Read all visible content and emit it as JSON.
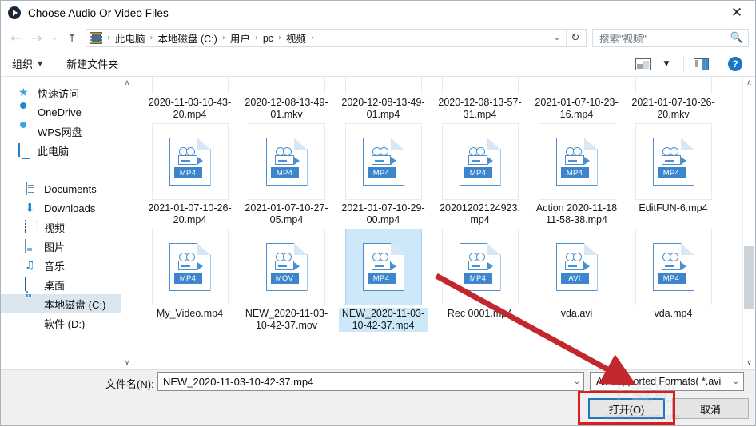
{
  "window": {
    "title": "Choose Audio Or Video Files",
    "app_icon": "play-circle-icon",
    "close_label": "✕"
  },
  "nav": {
    "back": "←",
    "forward": "→",
    "history": "⌄",
    "up": "↑",
    "breadcrumb": [
      "此电脑",
      "本地磁盘 (C:)",
      "用户",
      "pc",
      "视频"
    ],
    "separator": "›",
    "dropdown": "⌄",
    "refresh": "↻"
  },
  "search": {
    "placeholder": "搜索\"视频\"",
    "icon": "search-icon"
  },
  "toolbar": {
    "organize": "组织",
    "organize_caret": "▼",
    "new_folder": "新建文件夹",
    "view_caret": "▼",
    "help": "?"
  },
  "sidebar": {
    "items": [
      {
        "label": "快速访问",
        "icon": "star-icon",
        "indent": false,
        "selected": false
      },
      {
        "label": "OneDrive",
        "icon": "cloud-icon",
        "indent": false,
        "selected": false
      },
      {
        "label": "WPS网盘",
        "icon": "wps-cloud-icon",
        "indent": false,
        "selected": false
      },
      {
        "label": "此电脑",
        "icon": "this-pc-icon",
        "indent": false,
        "selected": false
      },
      {
        "label": "",
        "icon": "green-app-icon",
        "indent": true,
        "selected": false
      },
      {
        "label": "Documents",
        "icon": "documents-icon",
        "indent": true,
        "selected": false
      },
      {
        "label": "Downloads",
        "icon": "downloads-icon",
        "indent": true,
        "selected": false
      },
      {
        "label": "视频",
        "icon": "videos-icon",
        "indent": true,
        "selected": false
      },
      {
        "label": "图片",
        "icon": "pictures-icon",
        "indent": true,
        "selected": false
      },
      {
        "label": "音乐",
        "icon": "music-icon",
        "indent": true,
        "selected": false
      },
      {
        "label": "桌面",
        "icon": "desktop-icon",
        "indent": true,
        "selected": false
      },
      {
        "label": "本地磁盘 (C:)",
        "icon": "drive-icon",
        "indent": true,
        "selected": true
      },
      {
        "label": "软件 (D:)",
        "icon": "drive-plain-icon",
        "indent": true,
        "selected": false
      }
    ],
    "scroll_up": "∧",
    "scroll_down": "∨"
  },
  "files": [
    {
      "name": "2020-11-03-10-43-20.mp4",
      "ext": "MP4",
      "selected": false,
      "clipped": true
    },
    {
      "name": "2020-12-08-13-49-01.mkv",
      "ext": "MKV",
      "selected": false,
      "clipped": true
    },
    {
      "name": "2020-12-08-13-49-01.mp4",
      "ext": "MP4",
      "selected": false,
      "clipped": true
    },
    {
      "name": "2020-12-08-13-57-31.mp4",
      "ext": "MP4",
      "selected": false,
      "clipped": true
    },
    {
      "name": "2021-01-07-10-23-16.mp4",
      "ext": "MP4",
      "selected": false,
      "clipped": true
    },
    {
      "name": "2021-01-07-10-26-20.mkv",
      "ext": "MKV",
      "selected": false,
      "clipped": true
    },
    {
      "name": "2021-01-07-10-26-20.mp4",
      "ext": "MP4",
      "selected": false,
      "clipped": false
    },
    {
      "name": "2021-01-07-10-27-05.mp4",
      "ext": "MP4",
      "selected": false,
      "clipped": false
    },
    {
      "name": "2021-01-07-10-29-00.mp4",
      "ext": "MP4",
      "selected": false,
      "clipped": false
    },
    {
      "name": "20201202124923.mp4",
      "ext": "MP4",
      "selected": false,
      "clipped": false
    },
    {
      "name": "Action 2020-11-18 11-58-38.mp4",
      "ext": "MP4",
      "selected": false,
      "clipped": false
    },
    {
      "name": "EditFUN-6.mp4",
      "ext": "MP4",
      "selected": false,
      "clipped": false
    },
    {
      "name": "My_Video.mp4",
      "ext": "MP4",
      "selected": false,
      "clipped": false
    },
    {
      "name": "NEW_2020-11-03-10-42-37.mov",
      "ext": "MOV",
      "selected": false,
      "clipped": false
    },
    {
      "name": "NEW_2020-11-03-10-42-37.mp4",
      "ext": "MP4",
      "selected": true,
      "clipped": false
    },
    {
      "name": "Rec 0001.mp4",
      "ext": "MP4",
      "selected": false,
      "clipped": false
    },
    {
      "name": "vda.avi",
      "ext": "AVI",
      "selected": false,
      "clipped": false
    },
    {
      "name": "vda.mp4",
      "ext": "MP4",
      "selected": false,
      "clipped": false
    }
  ],
  "filearea": {
    "scroll_up": "∧",
    "scroll_down": "∨"
  },
  "footer": {
    "filename_label": "文件名(N):",
    "filename_value": "NEW_2020-11-03-10-42-37.mp4",
    "filename_caret": "⌄",
    "filter_value": "All Supported Formats( *.avi",
    "filter_caret": "⌄",
    "open_button": "打开(O)",
    "cancel_button": "取消"
  },
  "annotations": {
    "arrow_color": "#c1272d",
    "rect_color": "#e01b1b"
  },
  "watermark": {
    "url": "www.xiazaiba.com",
    "glyph": "下载吧"
  }
}
